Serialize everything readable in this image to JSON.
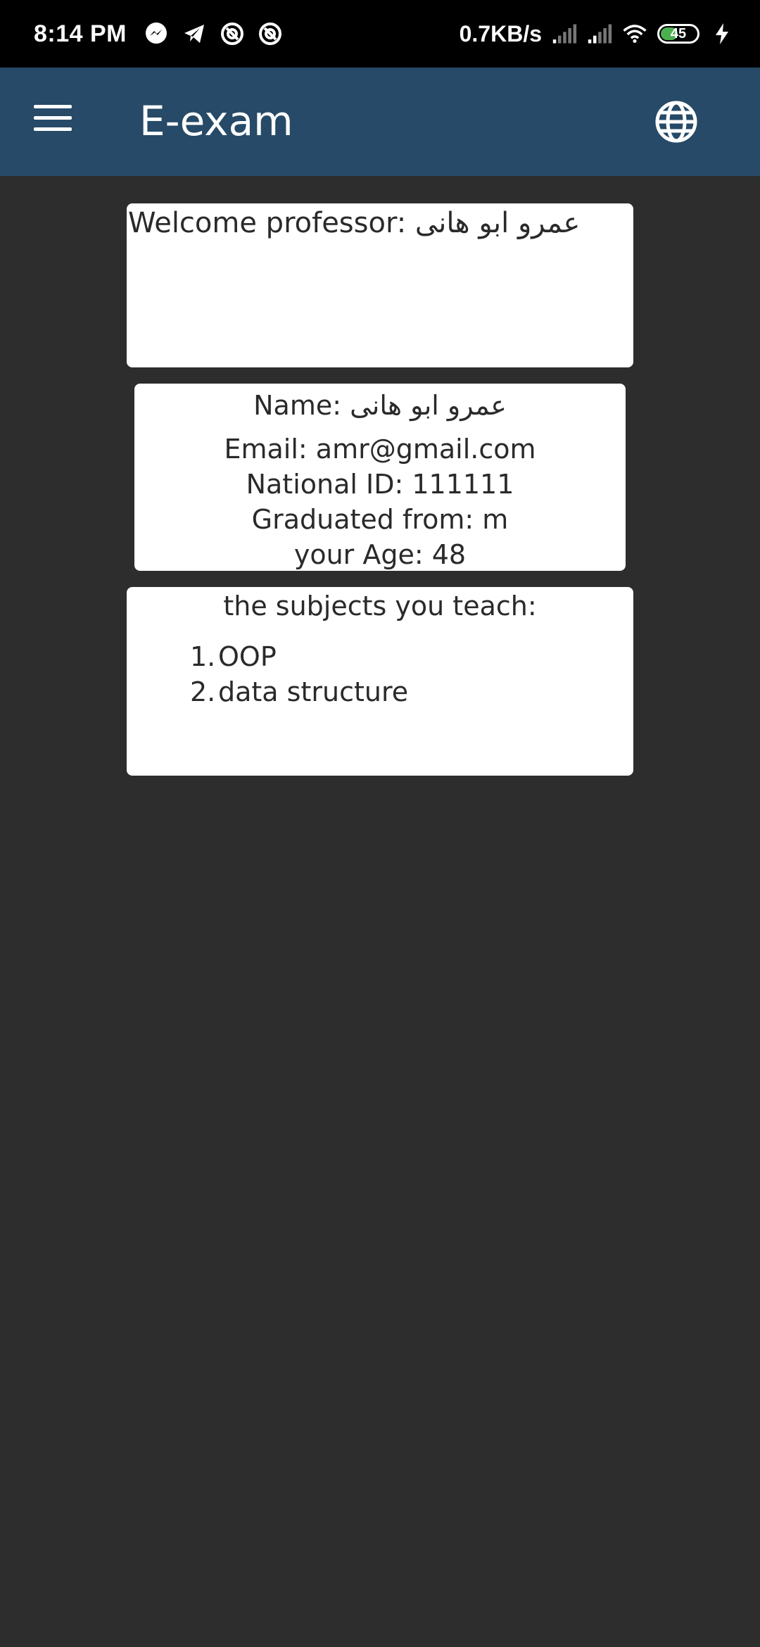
{
  "status_bar": {
    "time": "8:14 PM",
    "net_speed": "0.7KB/s",
    "battery": "45"
  },
  "app_bar": {
    "title": "E-exam"
  },
  "welcome": {
    "text": "Welcome professor: عمرو ابو هانى"
  },
  "profile": {
    "name": "Name: عمرو ابو هانى",
    "email": "Email: amr@gmail.com",
    "national_id": "National ID: 111111",
    "graduated": "Graduated from: m",
    "age": "your Age: 48"
  },
  "subjects": {
    "title": "the subjects you teach:",
    "items": [
      {
        "num": "1.",
        "label": "OOP"
      },
      {
        "num": "2.",
        "label": "data structure"
      }
    ]
  }
}
